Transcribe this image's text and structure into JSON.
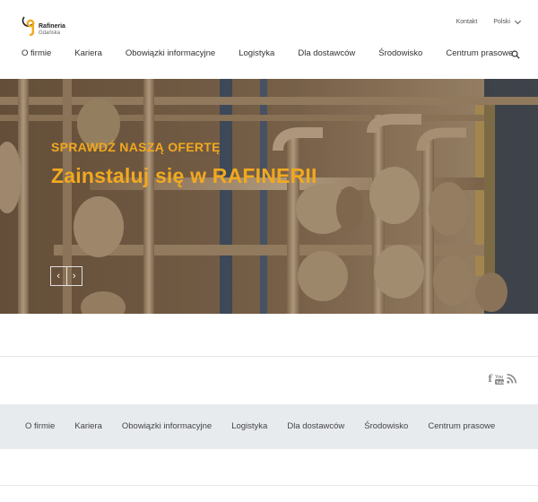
{
  "header": {
    "logo_name": "Rafineria",
    "logo_sub": "Gdańska",
    "top_links": {
      "contact": "Kontakt",
      "language": "Polski"
    },
    "nav": [
      "O firmie",
      "Kariera",
      "Obowiązki informacyjne",
      "Logistyka",
      "Dla dostawców",
      "Środowisko",
      "Centrum prasowe"
    ]
  },
  "hero": {
    "subtitle": "SPRAWDŹ NASZĄ OFERTĘ",
    "title": "Zainstaluj się w RAFINERII",
    "prev": "‹",
    "next": "›",
    "accent_color": "#f2a91f"
  },
  "social": {
    "facebook": "f",
    "youtube": "You Tube",
    "rss": "rss"
  },
  "footer": {
    "nav": [
      "O firmie",
      "Kariera",
      "Obowiązki informacyjne",
      "Logistyka",
      "Dla dostawców",
      "Środowisko",
      "Centrum prasowe"
    ]
  }
}
